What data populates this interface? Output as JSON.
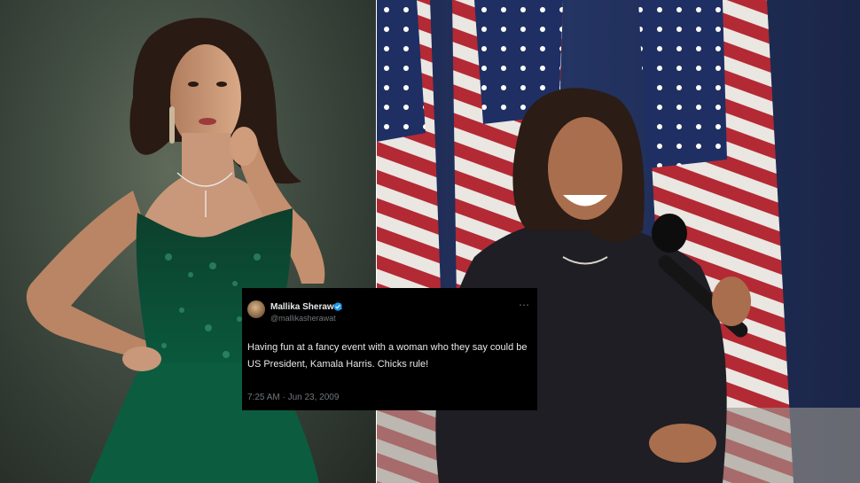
{
  "tweet": {
    "display_name": "Mallika Sherawat",
    "handle": "@mallikasherawat",
    "more_icon": "⋯",
    "text": "Having fun at a fancy event with a woman who they say could be US President, Kamala Harris. Chicks rule!",
    "timestamp": "7:25 AM · Jun 23, 2009",
    "verified_color": "#1d9bf0"
  },
  "colors": {
    "dress_green": "#0f5a3e",
    "flag_red": "#b32a34",
    "flag_blue": "#1f2f63",
    "suit_dark": "#1e1e24"
  }
}
